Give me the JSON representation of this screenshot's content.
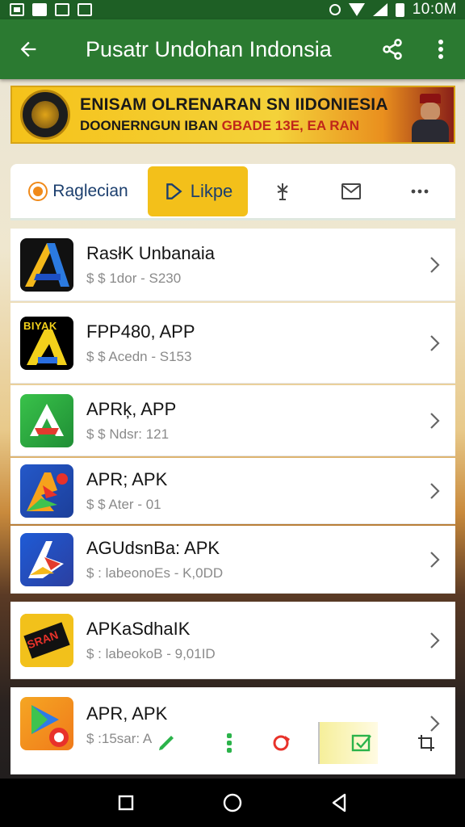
{
  "status_bar": {
    "time": "10:0M"
  },
  "app_bar": {
    "title": "Pusatr Undohan Indonsia"
  },
  "banner": {
    "line1": "ENISAM OLRENARAN SN IIDONIESIA",
    "line2_main": "DOONERNGUN IBAN ",
    "line2_highlight": "GBADE 13E, EA RAN"
  },
  "tabs": [
    {
      "label": "Raglecian",
      "icon": "circle-dot-icon"
    },
    {
      "label": "Likpe",
      "icon": "play-outline-icon",
      "active": true
    },
    {
      "label": "",
      "icon": "antenna-icon"
    },
    {
      "label": "",
      "icon": "mail-icon"
    },
    {
      "label": "",
      "icon": "more-horizontal-icon"
    }
  ],
  "apps": [
    {
      "title": "RasłK Unbanaia",
      "subtitle": "$ $ 1dor - S230",
      "icon": "app-a-icon"
    },
    {
      "title": "FPP480, APP",
      "subtitle": "$ $ Acedn - S153",
      "icon": "app-b-icon",
      "icon_text": "BIYAK"
    },
    {
      "title": "APRķ, APP",
      "subtitle": "$ $ Ndsr: 121",
      "icon": "app-c-icon"
    },
    {
      "title": "APR; APK",
      "subtitle": "$ $ Ater - 01",
      "icon": "app-d-icon"
    },
    {
      "title": "AGUdsnBa: APK",
      "subtitle": "$ : labeonoEs - K,0DD",
      "icon": "app-e-icon"
    },
    {
      "title": "APKaSdhaIK",
      "subtitle": "$ : labeokoB - 9,01ID",
      "icon": "app-f-icon",
      "icon_text": "SRAN"
    },
    {
      "title": "APR, APK",
      "subtitle": "$ :15sar: A",
      "icon": "app-g-icon"
    }
  ],
  "colors": {
    "status_bar": "#1e5f25",
    "app_bar": "#2b7a31",
    "active_tab": "#f3c01a",
    "banner": "#f5c21a"
  }
}
